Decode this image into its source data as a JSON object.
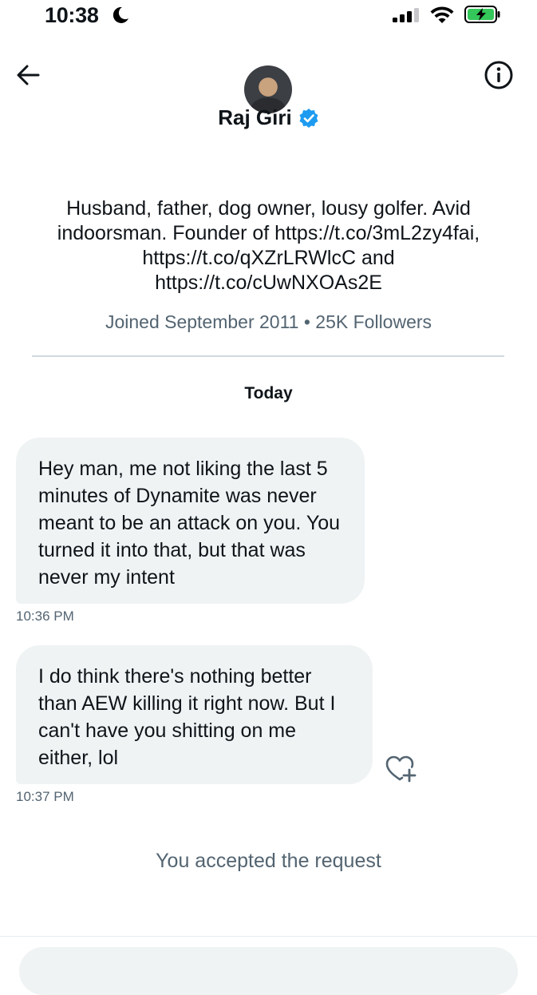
{
  "status_bar": {
    "time": "10:38",
    "icons": [
      "moon-icon",
      "signal-icon",
      "wifi-icon",
      "battery-charging-icon"
    ]
  },
  "header": {
    "back_icon": "arrow-left-icon",
    "info_icon": "info-icon",
    "name": "Raj Giri",
    "verified_icon": "verified-badge-icon"
  },
  "profile": {
    "bio": "Husband, father, dog owner, lousy golfer. Avid indoorsman. Founder of https://t.co/3mL2zy4fai, https://t.co/qXZrLRWlcC and https://t.co/cUwNXOAs2E",
    "meta": "Joined September 2011 • 25K Followers"
  },
  "conversation": {
    "day_label": "Today",
    "messages": [
      {
        "text": "Hey man, me not liking the last 5 minutes of Dynamite was never meant to be an attack on you. You turned it into that, but that was never my intent",
        "time": "10:36 PM"
      },
      {
        "text": "I do think there's nothing better than AEW killing it right now. But I can't have you shitting on me either, lol",
        "time": "10:37 PM"
      }
    ],
    "react_icon": "heart-plus-icon",
    "system_message": "You accepted the request"
  },
  "colors": {
    "verified": "#1d9bf0",
    "bubble_bg": "#eff3f4",
    "secondary_text": "#536471",
    "battery_green": "#34c759"
  }
}
